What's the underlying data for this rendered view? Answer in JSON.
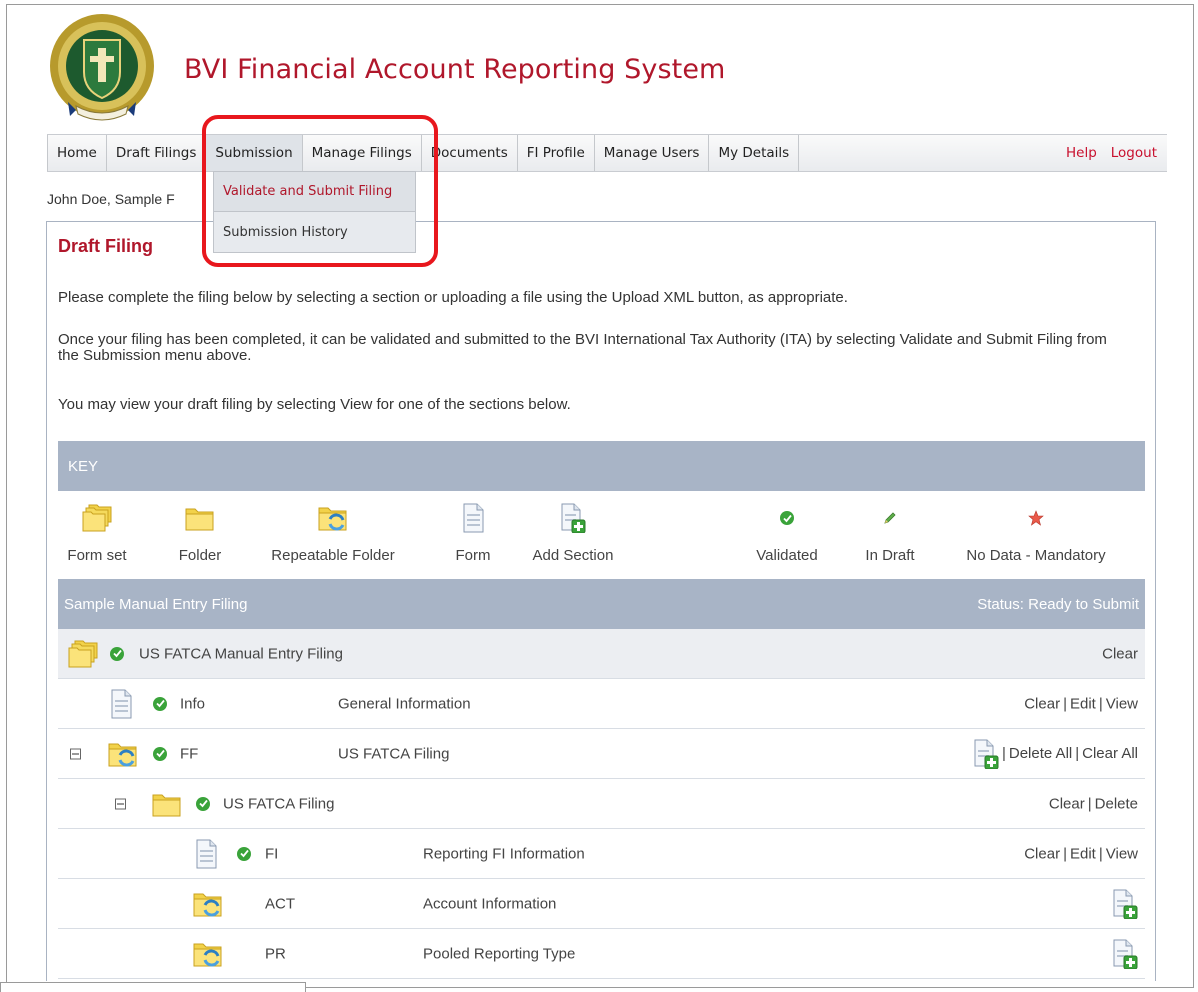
{
  "header": {
    "title": "BVI Financial Account Reporting System",
    "crest_text": "VIGILATE"
  },
  "nav": {
    "items": [
      "Home",
      "Draft Filings",
      "Submission",
      "Manage Filings",
      "Documents",
      "FI Profile",
      "Manage Users",
      "My Details"
    ],
    "help": "Help",
    "logout": "Logout"
  },
  "dropdown": {
    "items": [
      "Validate and Submit Filing",
      "Submission History"
    ]
  },
  "user_line": "John Doe, Sample F",
  "panel": {
    "title": "Draft Filing",
    "p1": "Please complete the filing below by selecting a section or uploading a file using the Upload XML button, as appropriate.",
    "p2": "Once your filing has been completed, it can be validated and submitted to the BVI International Tax Authority (ITA) by selecting Validate and Submit Filing from the Submission menu above.",
    "p3": "You may view your draft filing by selecting View for one of the sections below."
  },
  "key": {
    "header": "KEY",
    "items": [
      "Form set",
      "Folder",
      "Repeatable Folder",
      "Form",
      "Add Section",
      "Validated",
      "In Draft",
      "No Data - Mandatory"
    ]
  },
  "filing": {
    "name": "Sample Manual Entry Filing",
    "status": "Status: Ready to Submit",
    "rows": [
      {
        "code": "US FATCA Manual Entry Filing",
        "desc": "",
        "actions": [
          "Clear"
        ]
      },
      {
        "code": "Info",
        "desc": "General Information",
        "actions": [
          "Clear",
          "Edit",
          "View"
        ]
      },
      {
        "code": "FF",
        "desc": "US FATCA Filing",
        "actions": [
          "Delete All",
          "Clear All"
        ]
      },
      {
        "code": "US FATCA Filing",
        "desc": "",
        "actions": [
          "Clear",
          "Delete"
        ]
      },
      {
        "code": "FI",
        "desc": "Reporting FI Information",
        "actions": [
          "Clear",
          "Edit",
          "View"
        ]
      },
      {
        "code": "ACT",
        "desc": "Account Information",
        "actions": []
      },
      {
        "code": "PR",
        "desc": "Pooled Reporting Type",
        "actions": []
      }
    ],
    "separator": "|"
  },
  "colors": {
    "brand_red": "#b0172b",
    "key_bar": "#a8b4c6",
    "validated_green": "#3aa33a",
    "highlight": "#e8171d"
  }
}
